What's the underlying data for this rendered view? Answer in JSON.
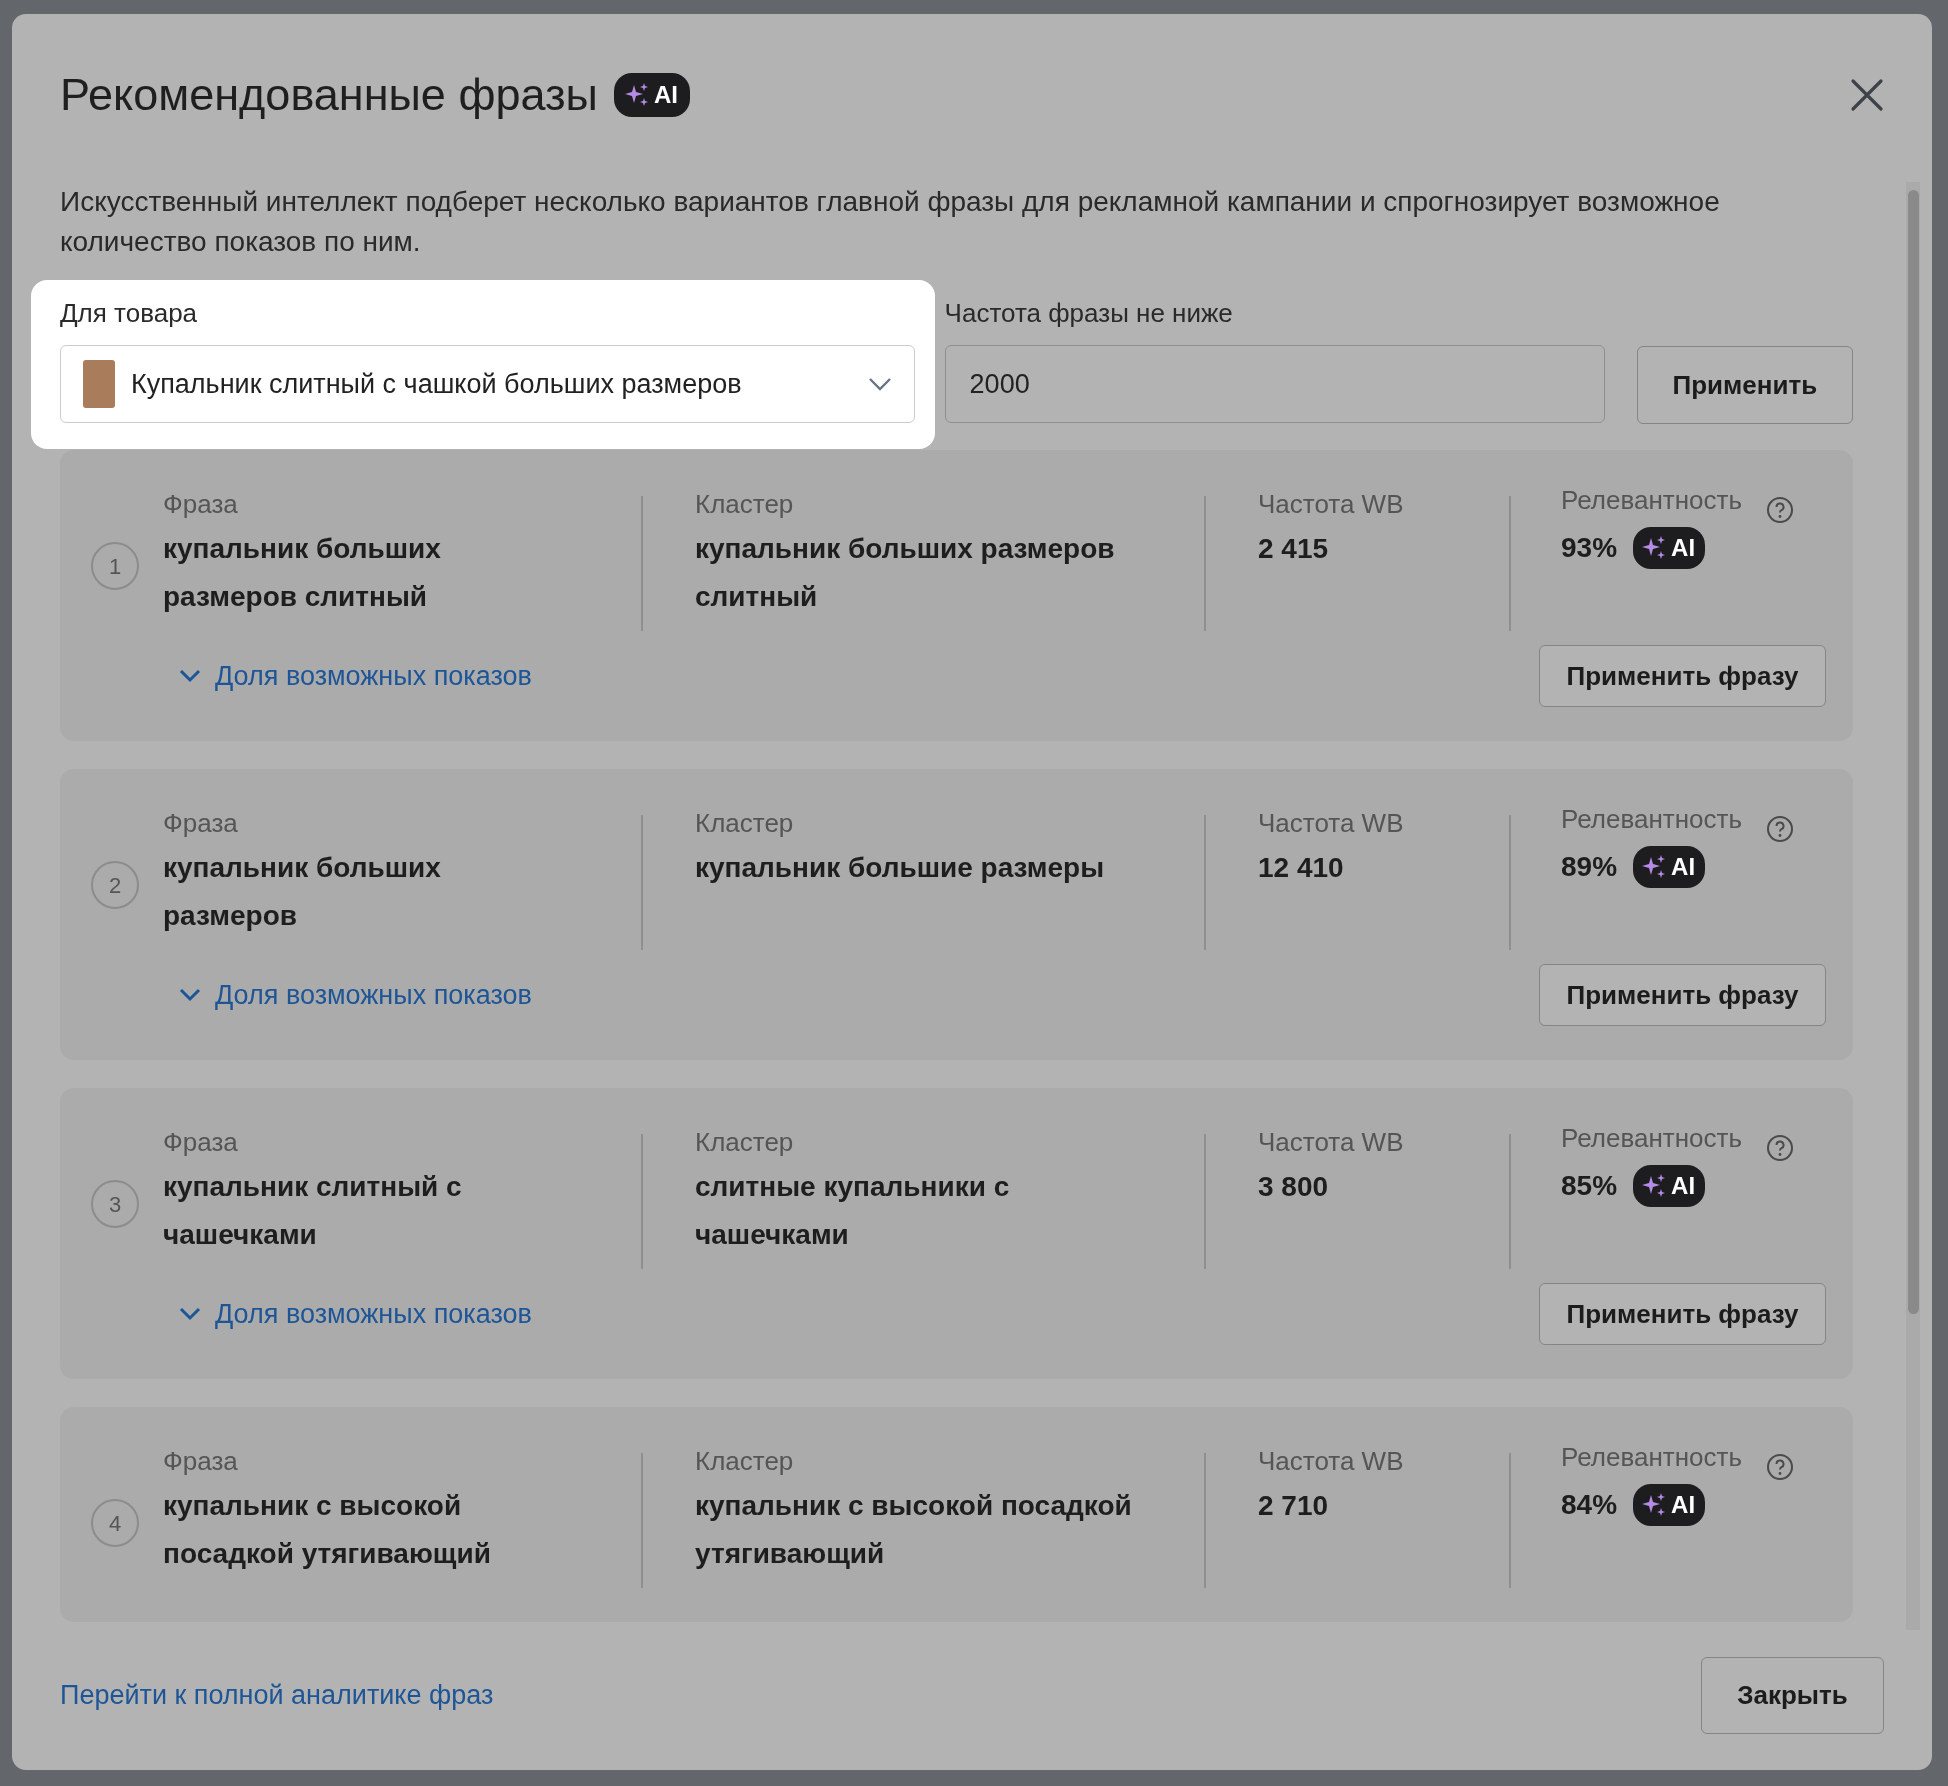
{
  "title": "Рекомендованные фразы",
  "title_badge": "AI",
  "description": "Искусственный интеллект подберет несколько вариантов главной фразы для рекламной кампании и спрогнозирует возможное количество показов по ним.",
  "product": {
    "label": "Для товара",
    "value": "Купальник слитный с чашкой больших размеров",
    "highlighted": true
  },
  "frequency": {
    "label": "Частота фразы не ниже",
    "value": "2000"
  },
  "apply_button": "Применить",
  "phrases": [
    {
      "number": "1",
      "phrase_label": "Фраза",
      "phrase": "купальник больших размеров слитный",
      "cluster_label": "Кластер",
      "cluster": "купальник больших размеров слитный",
      "freq_label": "Частота WB",
      "freq": "2 415",
      "rel_label": "Релевантность",
      "relevance": "93%",
      "badge": "AI",
      "expand_label": "Доля возможных показов",
      "expanded": false,
      "apply_label": "Применить фразу"
    },
    {
      "number": "2",
      "phrase_label": "Фраза",
      "phrase": "купальник больших размеров",
      "cluster_label": "Кластер",
      "cluster": "купальник большие размеры",
      "freq_label": "Частота WB",
      "freq": "12 410",
      "rel_label": "Релевантность",
      "relevance": "89%",
      "badge": "AI",
      "expand_label": "Доля возможных показов",
      "expanded": false,
      "apply_label": "Применить фразу"
    },
    {
      "number": "3",
      "phrase_label": "Фраза",
      "phrase": "купальник слитный с чашечками",
      "cluster_label": "Кластер",
      "cluster": "слитные купальники с чашечками",
      "freq_label": "Частота WB",
      "freq": "3 800",
      "rel_label": "Релевантность",
      "relevance": "85%",
      "badge": "AI",
      "expand_label": "Доля возможных показов",
      "expanded": false,
      "apply_label": "Применить фразу"
    },
    {
      "number": "4",
      "phrase_label": "Фраза",
      "phrase": "купальник с высокой посадкой утягивающий",
      "cluster_label": "Кластер",
      "cluster": "купальник с высокой посадкой утягивающий",
      "freq_label": "Частота WB",
      "freq": "2 710",
      "rel_label": "Релевантность",
      "relevance": "84%",
      "badge": "AI"
    }
  ],
  "footer_link": "Перейти к полной аналитике фраз",
  "close_button": "Закрыть"
}
